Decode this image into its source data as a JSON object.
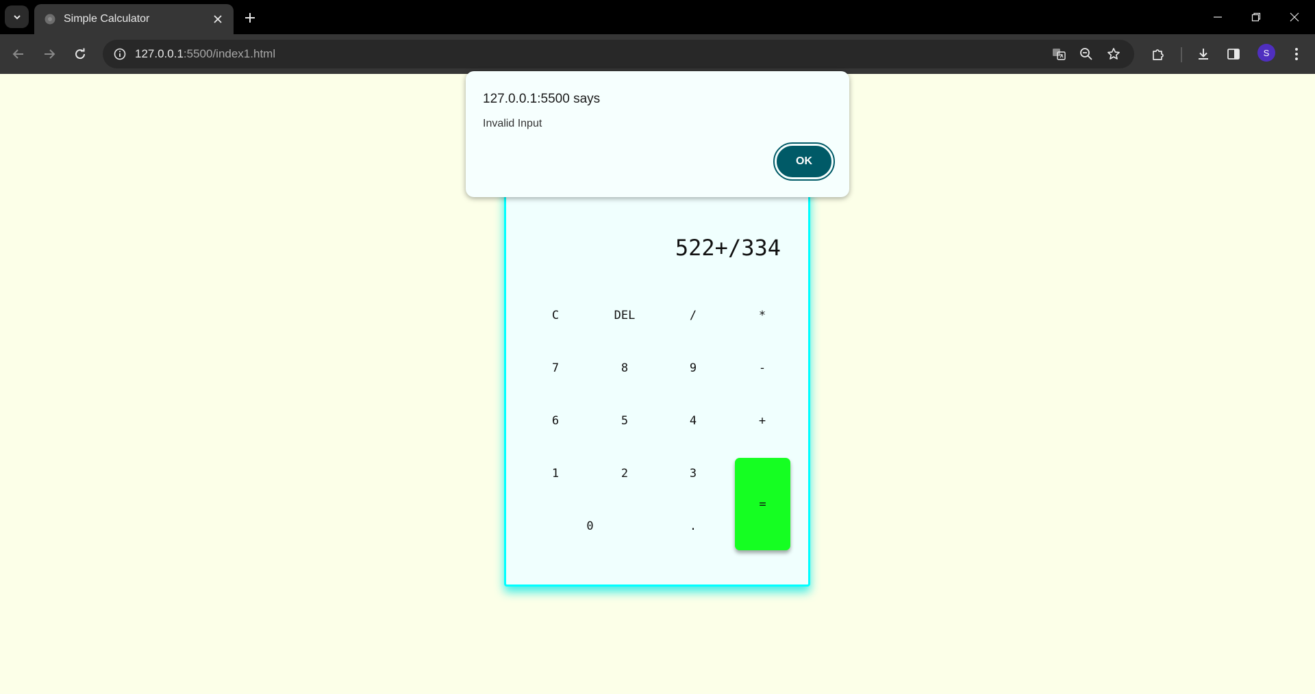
{
  "browser": {
    "tab_title": "Simple Calculator",
    "url_host": "127.0.0.1",
    "url_path": ":5500/index1.html",
    "profile_initial": "S"
  },
  "calculator": {
    "display": "522+/334",
    "keys": {
      "clear": "C",
      "delete": "DEL",
      "divide": "/",
      "multiply": "*",
      "seven": "7",
      "eight": "8",
      "nine": "9",
      "minus": "-",
      "six": "6",
      "five": "5",
      "four": "4",
      "plus": "+",
      "one": "1",
      "two": "2",
      "three": "3",
      "zero": "0",
      "decimal": ".",
      "equals": "="
    },
    "colors": {
      "border": "#00ffff",
      "equals": "#15ff22",
      "background": "#f0fffe"
    }
  },
  "dialog": {
    "title": "127.0.0.1:5500 says",
    "message": "Invalid Input",
    "ok_label": "OK",
    "ok_color": "#005a67"
  }
}
